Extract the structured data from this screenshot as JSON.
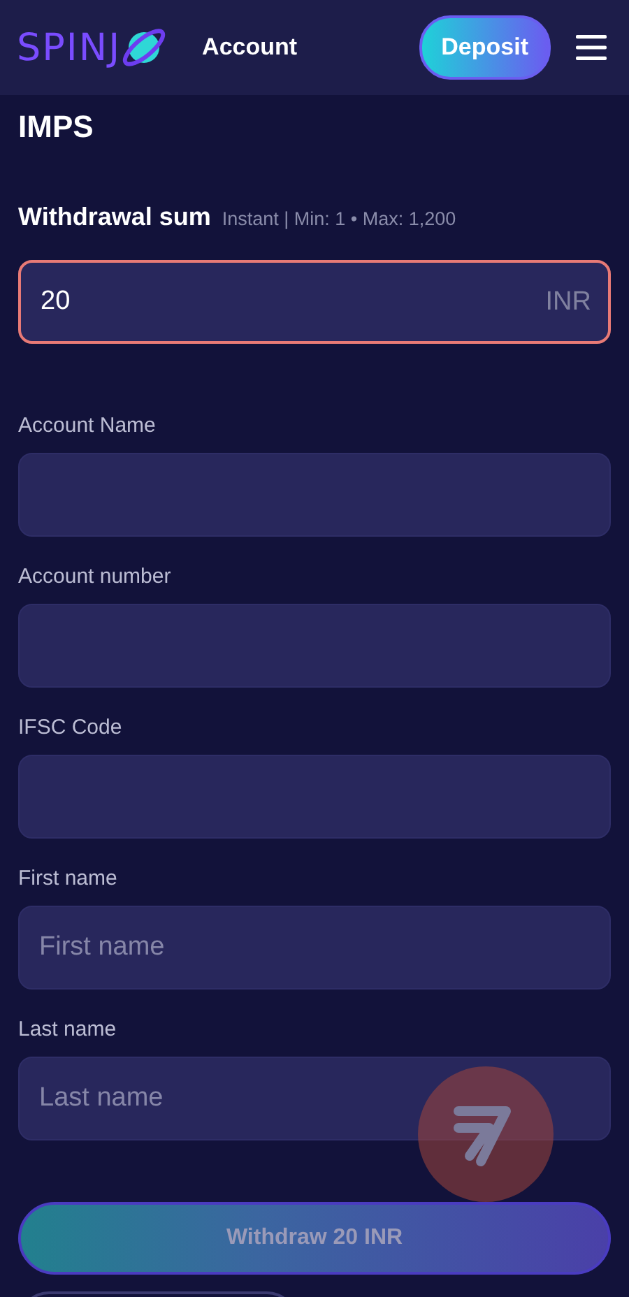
{
  "header": {
    "logo": "SPINJ",
    "title": "Account",
    "deposit_button": "Deposit"
  },
  "method": "IMPS",
  "amount": {
    "label": "Withdrawal sum",
    "hint": "Instant | Min: 1 • Max: 1,200",
    "value": "20",
    "currency": "INR",
    "invalid": true
  },
  "fields": [
    {
      "label": "Account Name"
    },
    {
      "label": "Account number"
    },
    {
      "label": "IFSC Code"
    },
    {
      "label": "First name",
      "placeholder": "First name"
    },
    {
      "label": "Last name",
      "placeholder": "Last name"
    }
  ],
  "submit": {
    "label": "Withdraw 20 INR",
    "disabled": true
  }
}
